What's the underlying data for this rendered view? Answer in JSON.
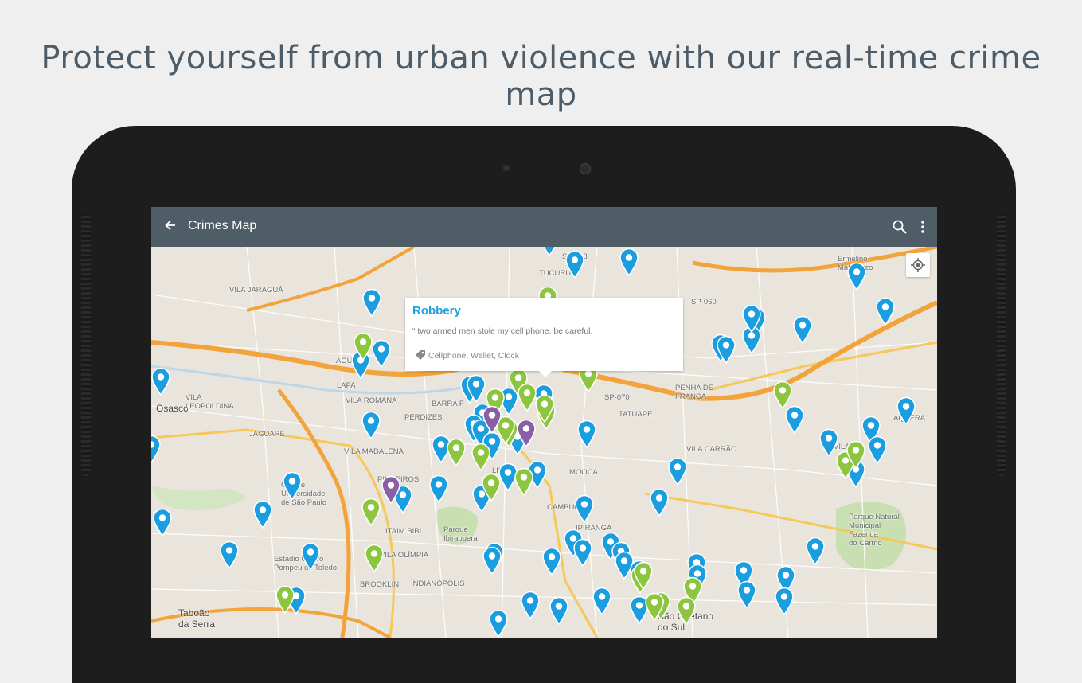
{
  "headline": "Protect yourself from urban violence with our real-time crime map",
  "app": {
    "title": "Crimes Map",
    "icons": {
      "back": "arrow-back-icon",
      "search": "search-icon",
      "overflow": "more-vert-icon",
      "locate": "my-location-icon"
    }
  },
  "popup": {
    "title": "Robbery",
    "quote": "“ two armed men stole my cell phone, be careful.",
    "tags": "Cellphone, Wallet, Clock"
  },
  "map_labels": {
    "osasco": "Osasco",
    "vila_leopoldina": "VILA\nLEOPOLDINA",
    "jaguare": "JAGUARÉ",
    "vila_romana": "VILA ROMANA",
    "lapa": "LAPA",
    "perdizes": "PERDIZES",
    "barra_funda": "BARRA F",
    "vila_madalena": "VILA MADALENA",
    "pinheiros": "PINHEIROS",
    "itaim_bibi": "ITAIM BIBI",
    "vila_olimpia": "VILA OLÍMPIA",
    "brooklin": "BROOKLIN",
    "indianopolis": "INDIANÓPOLIS",
    "parque_ibirapuera": "Parque\nIbirapuera",
    "mooca": "MOOCA",
    "tatuape": "TATUAPÉ",
    "penha_de_franca": "PENHA DE\nFRANÇA",
    "vila_carrao": "VILA CARRÃO",
    "tucuruvi": "TUCURU",
    "vila_jaragua": "VILA JARAGUÁ",
    "ermelino": "Ermelino\nMatarazzo",
    "parque_natural": "Parque Natural\nMunicipal\nFazenda\ndo Carmo",
    "cidade_universitaria": "Cidade\nUniversidade\nde São Paulo",
    "estadio": "Estádio Cícero\nPompeu de Toledo",
    "taboao": "Taboão\nda Serra",
    "sao_caetano": "São Caetano\ndo Sul",
    "aguia": "ÁGUA B",
    "carrao_sp": "SP-070",
    "sp008": "SP-008",
    "sp060": "SP-060",
    "aquera": "AQUERA",
    "vila_alpina": "VILA AL",
    "liberdade": "LIB",
    "ipiranga": "IPIRANGA",
    "cambuci": "CAMBUCI"
  },
  "colors": {
    "blue_pin": "#1a9ee0",
    "green_pin": "#8cc63f",
    "purple_pin": "#8b5fa8",
    "appbar": "#4f5d66",
    "headline": "#4c5c68"
  }
}
